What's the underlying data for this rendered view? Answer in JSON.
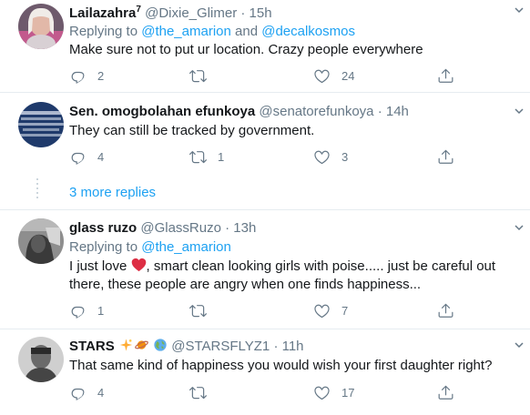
{
  "tweets": [
    {
      "name": "Lailazahra",
      "name_sup": "7",
      "handle": "@Dixie_Glimer",
      "time": "· 15h",
      "reply_prefix": "Replying to",
      "reply_user1": "@the_amarion",
      "reply_and": "and",
      "reply_user2": "@decalkosmos",
      "text": "Make sure not to put ur location. Crazy people everywhere",
      "replies": "2",
      "retweets": "",
      "likes": "24"
    },
    {
      "name": "Sen. omogbolahan efunkoya",
      "handle": "@senatorefunkoya",
      "time": "· 14h",
      "text": "They can still be tracked by government.",
      "replies": "4",
      "retweets": "1",
      "likes": "3"
    },
    {
      "name": "glass ruzo",
      "handle": "@GlassRuzo",
      "time": "· 13h",
      "reply_prefix": "Replying to",
      "reply_user1": "@the_amarion",
      "text_line1_a": "I just love",
      "text_line1_b": ", smart clean looking girls with poise..... just be careful out",
      "text_line2": "there, these people are angry when one finds happiness...",
      "replies": "1",
      "retweets": "",
      "likes": "7"
    },
    {
      "name": "STARS",
      "handle": "@STARSFLYZ1",
      "time": "· 11h",
      "text": "That same kind of happiness you would wish your first daughter right?",
      "replies": "4",
      "retweets": "",
      "likes": "17"
    }
  ],
  "more_replies": "3 more replies",
  "icons": [
    "reply-icon",
    "retweet-icon",
    "like-icon",
    "share-icon",
    "caret-down-icon",
    "heart-emoji-icon",
    "sparkle-emoji-icon",
    "planet-emoji-icon",
    "globe-emoji-icon"
  ],
  "colors": {
    "link": "#1da1f2",
    "muted": "#657786",
    "text": "#14171a",
    "divider": "#e6ecf0",
    "heart": "#e0245e"
  }
}
